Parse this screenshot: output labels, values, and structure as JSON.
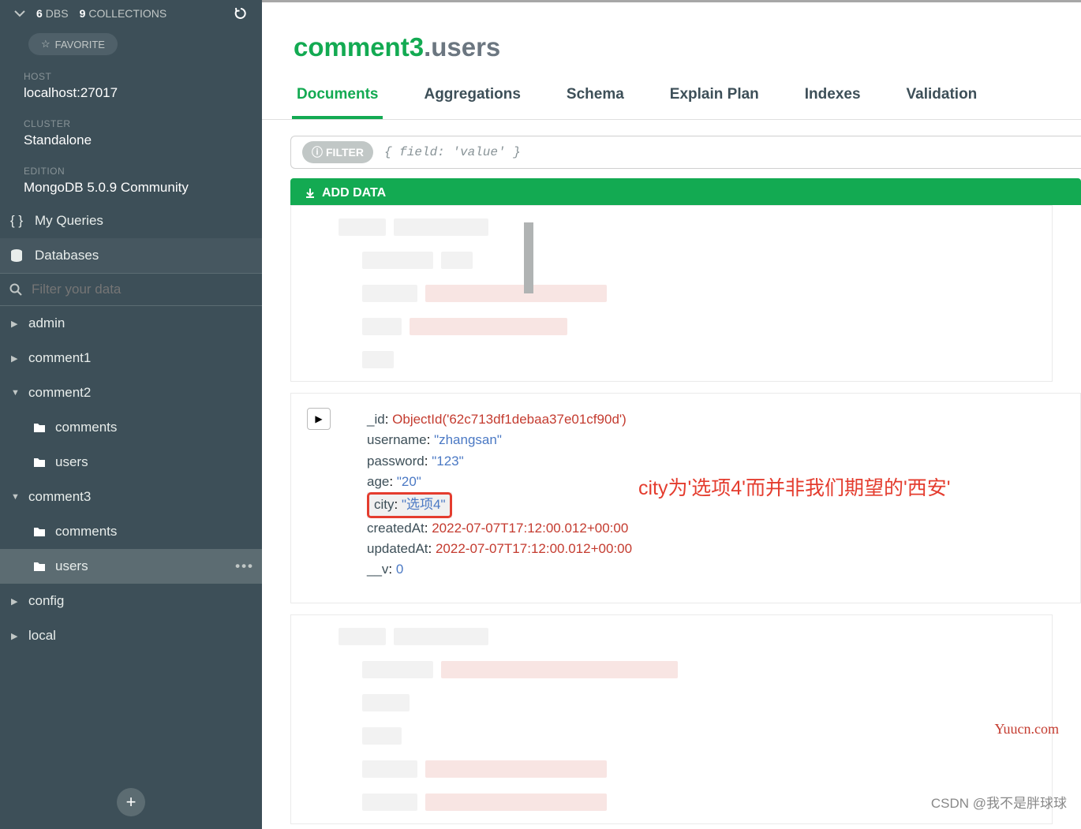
{
  "header": {
    "dbs_count": "6",
    "dbs_label": "DBS",
    "collections_count": "9",
    "collections_label": "COLLECTIONS",
    "favorite": "FAVORITE"
  },
  "info": {
    "host_label": "HOST",
    "host_value": "localhost:27017",
    "cluster_label": "CLUSTER",
    "cluster_value": "Standalone",
    "edition_label": "EDITION",
    "edition_value": "MongoDB 5.0.9 Community"
  },
  "nav": {
    "queries": "My Queries",
    "databases": "Databases",
    "filter_placeholder": "Filter your data"
  },
  "tree": [
    {
      "label": "admin",
      "expanded": false
    },
    {
      "label": "comment1",
      "expanded": false
    },
    {
      "label": "comment2",
      "expanded": true,
      "children": [
        "comments",
        "users"
      ]
    },
    {
      "label": "comment3",
      "expanded": true,
      "children": [
        "comments",
        "users"
      ],
      "selected_child": 1
    },
    {
      "label": "config",
      "expanded": false
    },
    {
      "label": "local",
      "expanded": false
    }
  ],
  "title": {
    "db": "comment3",
    "coll": ".users"
  },
  "tabs": [
    "Documents",
    "Aggregations",
    "Schema",
    "Explain Plan",
    "Indexes",
    "Validation"
  ],
  "active_tab": 0,
  "filter_label": "FILTER",
  "filter_placeholder": "{ field: 'value' }",
  "add_data": "ADD DATA",
  "document": {
    "_id_key": "_id",
    "_id_val": "ObjectId('62c713df1debaa37e01cf90d')",
    "username_key": "username",
    "username_val": "\"zhangsan\"",
    "password_key": "password",
    "password_val": "\"123\"",
    "age_key": "age",
    "age_val": "\"20\"",
    "city_key": "city",
    "city_val": "\"选项4\"",
    "createdAt_key": "createdAt",
    "createdAt_val": "2022-07-07T17:12:00.012+00:00",
    "updatedAt_key": "updatedAt",
    "updatedAt_val": "2022-07-07T17:12:00.012+00:00",
    "v_key": "__v",
    "v_val": "0"
  },
  "annotation": "city为'选项4'而并非我们期望的'西安'",
  "watermark1": "Yuucn.com",
  "watermark2": "CSDN @我不是胖球球"
}
